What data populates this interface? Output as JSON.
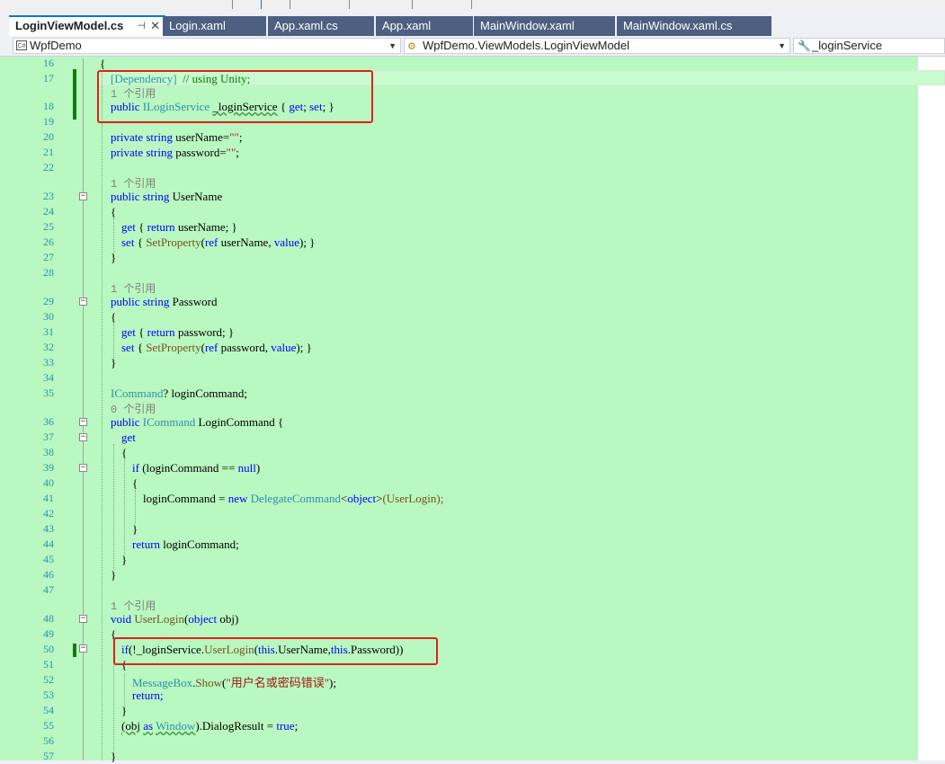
{
  "tabs": [
    {
      "label": "LoginViewModel.cs",
      "active": true
    },
    {
      "label": "Login.xaml",
      "active": false
    },
    {
      "label": "App.xaml.cs",
      "active": false
    },
    {
      "label": "App.xaml",
      "active": false
    },
    {
      "label": "MainWindow.xaml",
      "active": false
    },
    {
      "label": "MainWindow.xaml.cs",
      "active": false
    }
  ],
  "nav": {
    "project": "WpfDemo",
    "class": "WpfDemo.ViewModels.LoginViewModel",
    "member": "_loginService",
    "project_icon": "csharp-project-icon",
    "class_icon": "class-icon",
    "member_icon": "wrench-property-icon"
  },
  "colors": {
    "editor_background": "#b9f8c0",
    "keyword": "#0000ff",
    "type": "#2b91af",
    "comment": "#008000",
    "string": "#a31515",
    "highlight_box": "#e0201d",
    "tab_inactive": "#4d6082"
  },
  "lines": {
    "l16": "16",
    "l17": "17",
    "l18": "18",
    "l19": "19",
    "l20": "20",
    "l21": "21",
    "l22": "22",
    "l23": "23",
    "l24": "24",
    "l25": "25",
    "l26": "26",
    "l27": "27",
    "l28": "28",
    "l29": "29",
    "l30": "30",
    "l31": "31",
    "l32": "32",
    "l33": "33",
    "l34": "34",
    "l35": "35",
    "l36": "36",
    "l37": "37",
    "l38": "38",
    "l39": "39",
    "l40": "40",
    "l41": "41",
    "l42": "42",
    "l43": "43",
    "l44": "44",
    "l45": "45",
    "l46": "46",
    "l47": "47",
    "l48": "48",
    "l49": "49",
    "l50": "50",
    "l51": "51",
    "l52": "52",
    "l53": "53",
    "l54": "54",
    "l55": "55",
    "l56": "56",
    "l57": "57"
  },
  "refs": {
    "r1": "1 个引用",
    "r2": "1 个引用",
    "r3": "1 个引用",
    "r4": "0 个引用",
    "r5": "1 个引用"
  },
  "code": {
    "open_brace": "{",
    "dependency_attr": "[Dependency]",
    "using_comment": "// using Unity;",
    "public": "public",
    "iloginservice": "ILoginService",
    "login_service_prop": "_loginService",
    "get_set_open": "{",
    "get_kw": "get",
    "set_kw": "set",
    "get_set_close": "}",
    "private": "private",
    "string_kw": "string",
    "username_field": "userName=",
    "empty_string": "\"\"",
    "semicolon": ";",
    "password_field": "password=",
    "username_prop": "UserName",
    "password_prop": "Password",
    "return_kw": "return",
    "return_username": "userName; }",
    "return_password": "password; }",
    "setproperty": "SetProperty",
    "ref_kw": "ref",
    "set_username_rest": "userName,",
    "set_password_rest": "password,",
    "value_kw": "value",
    "close_paren_brace": "); }",
    "icommand": "ICommand",
    "login_command_field": "? loginCommand;",
    "login_command_prop": "LoginCommand {",
    "if_kw": "if",
    "if_login_cond": "(loginCommand ==",
    "null_kw": "null",
    "close_paren": ")",
    "login_command_assign": "loginCommand =",
    "new_kw": "new",
    "delegate_command": "DelegateCommand",
    "object_generic_open": "<",
    "object_kw": "object",
    "object_generic_close": ">",
    "userlogin_arg": "(UserLogin);",
    "return_login_command": "loginCommand;",
    "close_brace": "}",
    "void_kw": "void",
    "userlogin_method": "UserLogin",
    "obj_param_open": "(",
    "obj_param_rest": "obj)",
    "if_not": "(!_loginService.",
    "this_kw": "this",
    "username_arg": ".UserName,",
    "password_arg": ".Password))",
    "messagebox": "MessageBox",
    "show": "Show",
    "error_msg": "\"用户名或密码错误\"",
    "close_stmt": ");",
    "return_stmt": "return;",
    "obj_as_open": "(obj",
    "as_kw": "as",
    "window_type": "Window",
    "dialog_result": ").DialogResult =",
    "true_kw": "true",
    "dot": ".",
    "paren_open": "(",
    "space": " "
  }
}
